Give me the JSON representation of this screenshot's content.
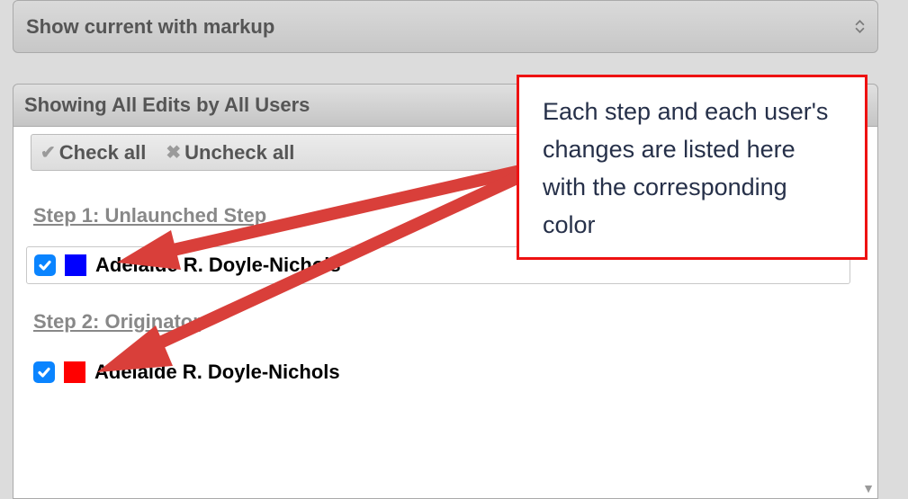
{
  "dropdown": {
    "label": "Show current with markup"
  },
  "header": {
    "label": "Showing All Edits by All Users"
  },
  "toolbar": {
    "check_all": "Check all",
    "uncheck_all": "Uncheck all"
  },
  "steps": [
    {
      "title": "Step 1: Unlaunched Step",
      "users": [
        {
          "name": "Adelaide R. Doyle-Nichols",
          "checked": true,
          "color": "#0000ff"
        }
      ]
    },
    {
      "title": "Step 2: Originator",
      "users": [
        {
          "name": "Adelaide R. Doyle-Nichols",
          "checked": true,
          "color": "#ff0000"
        }
      ]
    }
  ],
  "callout": {
    "text": "Each step and each user's changes are listed here with the corresponding color"
  }
}
